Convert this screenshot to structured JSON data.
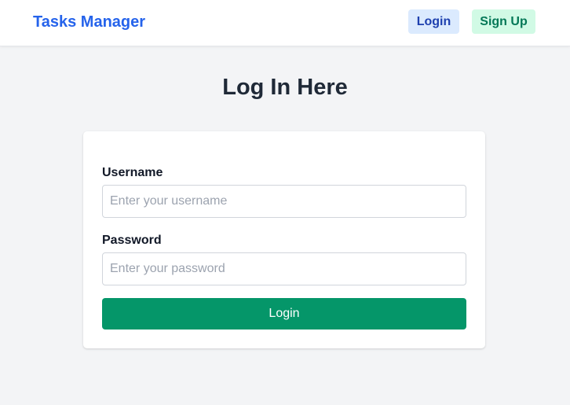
{
  "navbar": {
    "brand": "Tasks Manager",
    "login_label": "Login",
    "signup_label": "Sign Up"
  },
  "page": {
    "title": "Log In Here"
  },
  "form": {
    "username": {
      "label": "Username",
      "placeholder": "Enter your username",
      "value": ""
    },
    "password": {
      "label": "Password",
      "placeholder": "Enter your password",
      "value": ""
    },
    "submit_label": "Login"
  },
  "colors": {
    "brand": "#2563eb",
    "login_button_bg": "#dbeafe",
    "signup_button_bg": "#d1fae5",
    "submit_button_bg": "#059669",
    "page_background": "#f3f4f6"
  }
}
